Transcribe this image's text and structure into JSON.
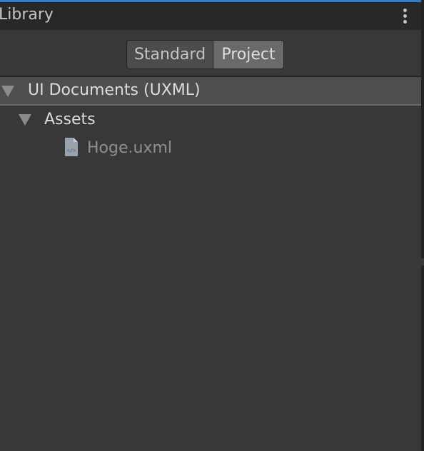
{
  "panel": {
    "title": "Library",
    "menu_icon": "kebab-menu-icon"
  },
  "toggle": {
    "options": [
      "Standard",
      "Project"
    ],
    "selected": "Project"
  },
  "tree": {
    "category": {
      "label": "UI Documents (UXML)",
      "expanded": true
    },
    "folder": {
      "label": "Assets",
      "expanded": true
    },
    "files": [
      {
        "label": "Hoge.uxml",
        "icon": "uxml-file-icon"
      }
    ]
  },
  "colors": {
    "accent": "#3a79bb",
    "background": "#383838",
    "header": "#282828",
    "selected_toggle": "#6a6a6a",
    "category_row": "#4e4e4e"
  }
}
